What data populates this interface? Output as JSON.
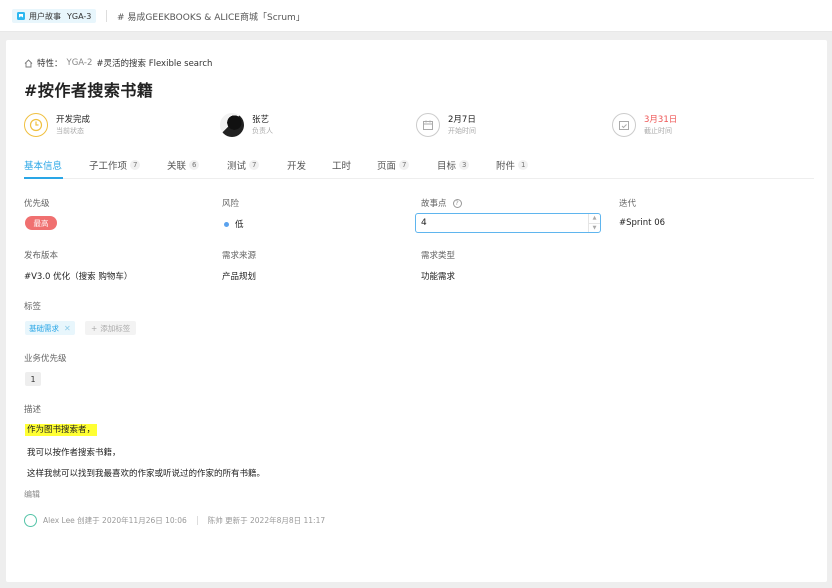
{
  "topbar": {
    "type_label": "用户故事",
    "item_id": "YGA-3",
    "project": "# 易成GEEKBOOKS & ALICE商城「Scrum」"
  },
  "breadcrumb": {
    "feature_label": "特性：",
    "feature_id": "YGA-2",
    "feature_title": "#灵活的搜索 Flexible search"
  },
  "title": "#按作者搜索书籍",
  "meta": {
    "status_value": "开发完成",
    "status_key": "当前状态",
    "owner_value": "张艺",
    "owner_key": "负责人",
    "start_value": "2月7日",
    "start_key": "开始时间",
    "due_value": "3月31日",
    "due_key": "截止时间"
  },
  "tabs": [
    {
      "label": "基本信息",
      "count": ""
    },
    {
      "label": "子工作项",
      "count": "7"
    },
    {
      "label": "关联",
      "count": "6"
    },
    {
      "label": "测试",
      "count": "7"
    },
    {
      "label": "开发",
      "count": ""
    },
    {
      "label": "工时",
      "count": ""
    },
    {
      "label": "页面",
      "count": "7"
    },
    {
      "label": "目标",
      "count": "3"
    },
    {
      "label": "附件",
      "count": "1"
    }
  ],
  "fields": {
    "priority_label": "优先级",
    "priority_value": "最高",
    "risk_label": "风险",
    "risk_value": "低",
    "story_points_label": "故事点",
    "story_points_value": "4",
    "iteration_label": "迭代",
    "iteration_value": "#Sprint 06",
    "release_label": "发布版本",
    "release_value": "#V3.0 优化（搜索 购物车）",
    "source_label": "需求来源",
    "source_value": "产品规划",
    "req_type_label": "需求类型",
    "req_type_value": "功能需求",
    "tags_label": "标签",
    "tag_value": "基础需求",
    "add_tag_label": "添加标签",
    "biz_priority_label": "业务优先级",
    "biz_priority_value": "1"
  },
  "description": {
    "label": "描述",
    "line1": "作为图书搜索者，",
    "line2": "我可以按作者搜索书籍，",
    "line3": "这样我就可以找到我最喜欢的作家或听说过的作家的所有书籍。",
    "edit_label": "编辑"
  },
  "footer": {
    "created": "Alex Lee 创建于 2020年11月26日 10:06",
    "updated": "陈帅 更新于 2022年8月8日 11:17"
  },
  "colors": {
    "accent": "#2aa6e6",
    "priority_badge": "#f07070",
    "due_date": "#ee5555",
    "highlight": "#ffff33"
  }
}
